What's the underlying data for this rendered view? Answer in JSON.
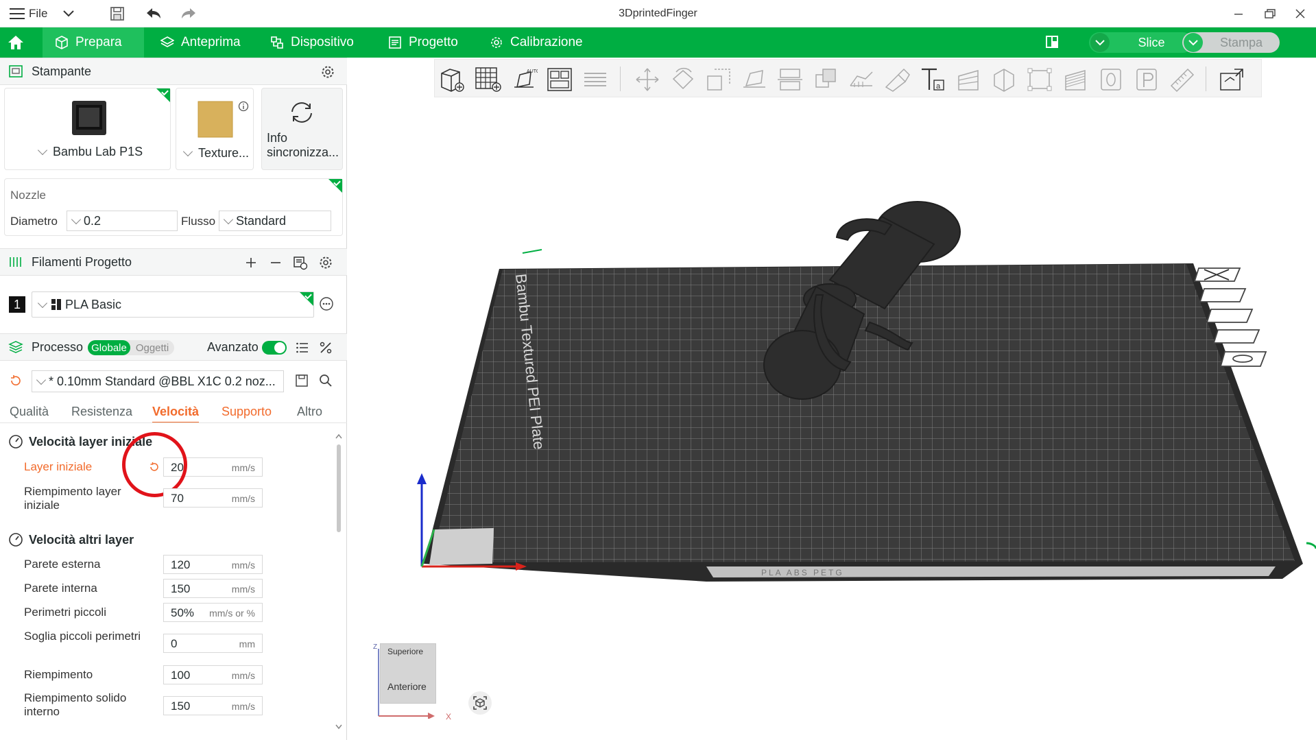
{
  "app": {
    "title": "3DprintedFinger",
    "file_menu": "File"
  },
  "nav": {
    "tabs": [
      "Prepara",
      "Anteprima",
      "Dispositivo",
      "Progetto",
      "Calibrazione"
    ],
    "active_tab": "Prepara",
    "slice_label": "Slice",
    "print_label": "Stampa",
    "accent": "#00ae42"
  },
  "printer": {
    "section_title": "Stampante",
    "printer_name": "Bambu Lab P1S",
    "plate_name": "Texture...",
    "sync_label_1": "Info",
    "sync_label_2": "sincronizza..."
  },
  "nozzle": {
    "title": "Nozzle",
    "diameter_label": "Diametro",
    "diameter_value": "0.2",
    "flow_label": "Flusso",
    "flow_value": "Standard"
  },
  "filaments": {
    "section_title": "Filamenti Progetto",
    "items": [
      {
        "index": "1",
        "name": "PLA Basic"
      }
    ]
  },
  "process": {
    "section_title": "Processo",
    "scope_global": "Globale",
    "scope_objects": "Oggetti",
    "advanced_label": "Avanzato",
    "advanced_on": true,
    "preset": "* 0.10mm Standard @BBL X1C 0.2 noz...",
    "tabs": [
      "Qualità",
      "Resistenza",
      "Velocità",
      "Supporto",
      "Altro"
    ],
    "active_tab": "Velocità",
    "groups": [
      {
        "title": "Velocità layer iniziale",
        "params": [
          {
            "label": "Layer iniziale",
            "value": "20",
            "unit": "mm/s",
            "modified": true
          },
          {
            "label": "Riempimento layer iniziale",
            "value": "70",
            "unit": "mm/s",
            "modified": false
          }
        ]
      },
      {
        "title": "Velocità altri layer",
        "params": [
          {
            "label": "Parete esterna",
            "value": "120",
            "unit": "mm/s"
          },
          {
            "label": "Parete interna",
            "value": "150",
            "unit": "mm/s"
          },
          {
            "label": "Perimetri piccoli",
            "value": "50%",
            "unit": "mm/s or %"
          },
          {
            "label": "Soglia piccoli perimetri",
            "value": "0",
            "unit": "mm"
          },
          {
            "label": "Riempimento",
            "value": "100",
            "unit": "mm/s"
          },
          {
            "label": "Riempimento solido interno",
            "value": "150",
            "unit": "mm/s"
          }
        ]
      }
    ]
  },
  "viewport": {
    "plate_label": "Bambu Textured PEI Plate",
    "plate_footer": "PLA ABS PETG",
    "view_cube_top": "Superiore",
    "view_cube_front": "Anteriore",
    "axis_z": "Z",
    "axis_x": "X"
  }
}
